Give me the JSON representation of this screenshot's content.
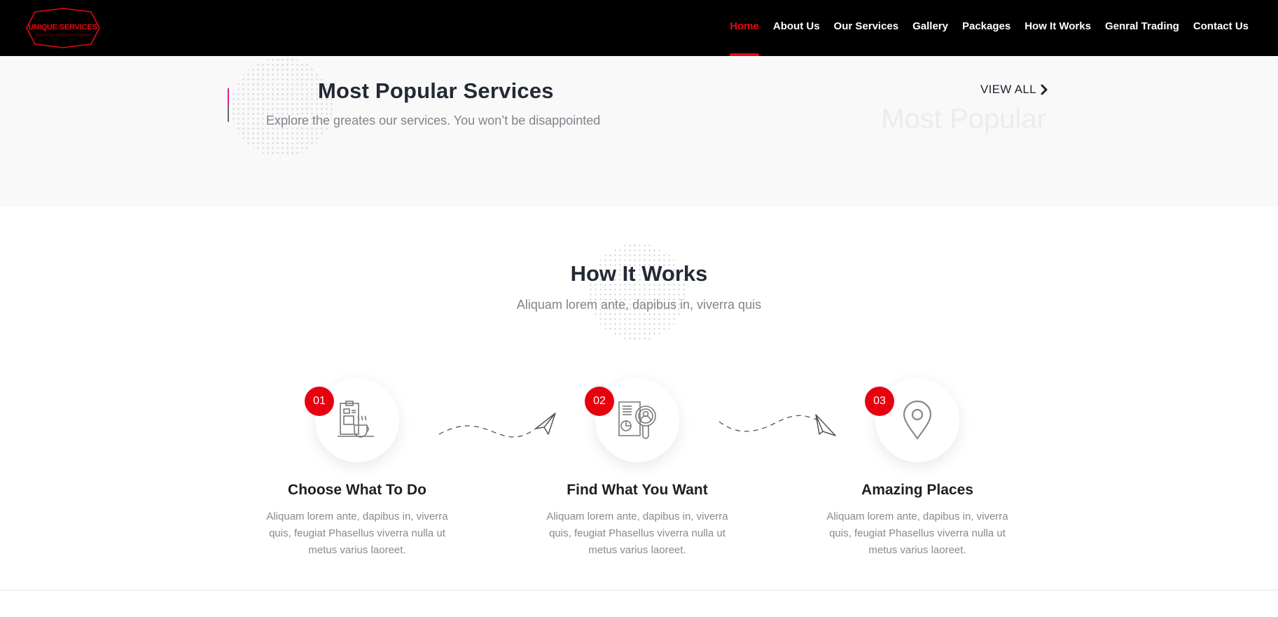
{
  "brand": {
    "logo_text": "UNIQUE SERVICES",
    "logo_subtext": "TECHNICAL SERVICES COMPANY",
    "accent_color": "#e50914"
  },
  "nav": {
    "items": [
      {
        "label": "Home",
        "active": true
      },
      {
        "label": "About Us",
        "active": false
      },
      {
        "label": "Our Services",
        "active": false
      },
      {
        "label": "Gallery",
        "active": false
      },
      {
        "label": "Packages",
        "active": false
      },
      {
        "label": "How It Works",
        "active": false
      },
      {
        "label": "Genral Trading",
        "active": false
      },
      {
        "label": "Contact Us",
        "active": false
      }
    ]
  },
  "popular": {
    "title": "Most Popular Services",
    "subtitle": "Explore the greates our services. You won’t be disappointed",
    "view_all_label": "VIEW ALL",
    "view_all_icon": "chevron-right-icon",
    "ghost_text": "Most Popular"
  },
  "how_it_works": {
    "title": "How It Works",
    "subtitle": "Aliquam lorem ante, dapibus in, viverra quis",
    "steps": [
      {
        "number": "01",
        "icon": "clipboard-coffee-icon",
        "title": "Choose What To Do",
        "description": "Aliquam lorem ante, dapibus in, viverra quis, feugiat Phasellus viverra nulla ut metus varius laoreet."
      },
      {
        "number": "02",
        "icon": "document-search-icon",
        "title": "Find What You Want",
        "description": "Aliquam lorem ante, dapibus in, viverra quis, feugiat Phasellus viverra nulla ut metus varius laoreet."
      },
      {
        "number": "03",
        "icon": "map-pin-icon",
        "title": "Amazing Places",
        "description": "Aliquam lorem ante, dapibus in, viverra quis, feugiat Phasellus viverra nulla ut metus varius laoreet."
      }
    ],
    "connector_icon": "paper-plane-icon"
  }
}
